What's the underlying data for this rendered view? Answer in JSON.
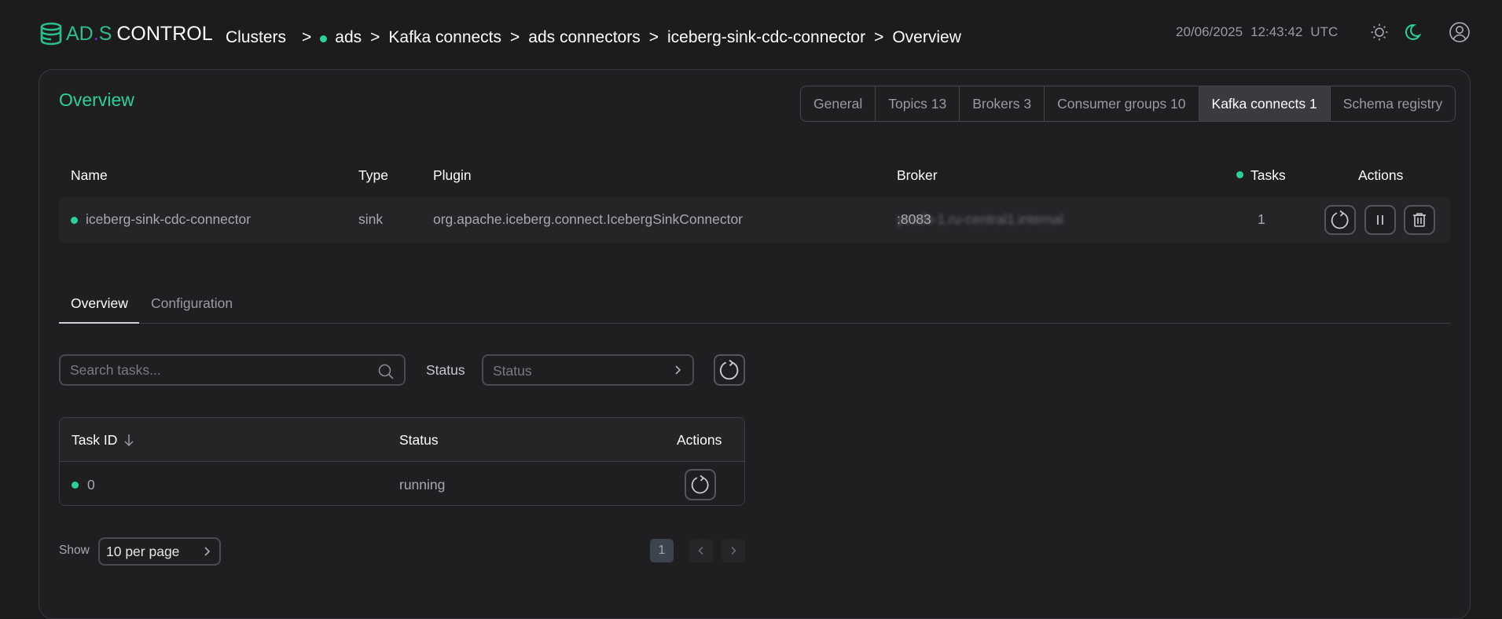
{
  "header": {
    "logo": {
      "ads": "AD",
      "dot": ".",
      "s": "S",
      "control": "CONTROL"
    },
    "breadcrumb": {
      "clusters": "Clusters",
      "separator": ">",
      "cluster": "ads",
      "kafka_connects": "Kafka connects",
      "connect_group": "ads connectors",
      "connector": "iceberg-sink-cdc-connector",
      "current": "Overview"
    },
    "date": "20/06/2025",
    "time": "12:43:42",
    "timezone": "UTC",
    "icons": [
      "sun-icon",
      "moon-icon",
      "user-icon"
    ]
  },
  "panel": {
    "title": "Overview",
    "tabs": [
      {
        "label": "General"
      },
      {
        "label": "Topics 13"
      },
      {
        "label": "Brokers 3"
      },
      {
        "label": "Consumer groups 10"
      },
      {
        "label": "Kafka connects 1",
        "active": true
      },
      {
        "label": "Schema registry"
      }
    ]
  },
  "connector_table": {
    "headers": {
      "name": "Name",
      "type": "Type",
      "plugin": "Plugin",
      "broker": "Broker",
      "tasks": "Tasks",
      "actions": "Actions"
    },
    "row": {
      "name": "iceberg-sink-cdc-connector",
      "type": "sink",
      "plugin": "org.apache.iceberg.connect.IcebergSinkConnector",
      "broker_host": "ycsdb-1.ru-central1.internal",
      "broker_port": ":8083",
      "tasks": "1",
      "status_color": "#2bd19a"
    }
  },
  "subtabs": {
    "overview": "Overview",
    "configuration": "Configuration"
  },
  "filters": {
    "search_placeholder": "Search tasks...",
    "status_label": "Status",
    "status_placeholder": "Status"
  },
  "tasks_table": {
    "headers": {
      "task_id": "Task ID",
      "status": "Status",
      "actions": "Actions"
    },
    "rows": [
      {
        "id": "0",
        "status": "running"
      }
    ]
  },
  "pagination": {
    "show_label": "Show",
    "per_page": "10 per page",
    "current_page": "1"
  },
  "colors": {
    "accent": "#2bd19a",
    "background": "#1c1c1e",
    "logo_dot": "#8b2fd6"
  }
}
